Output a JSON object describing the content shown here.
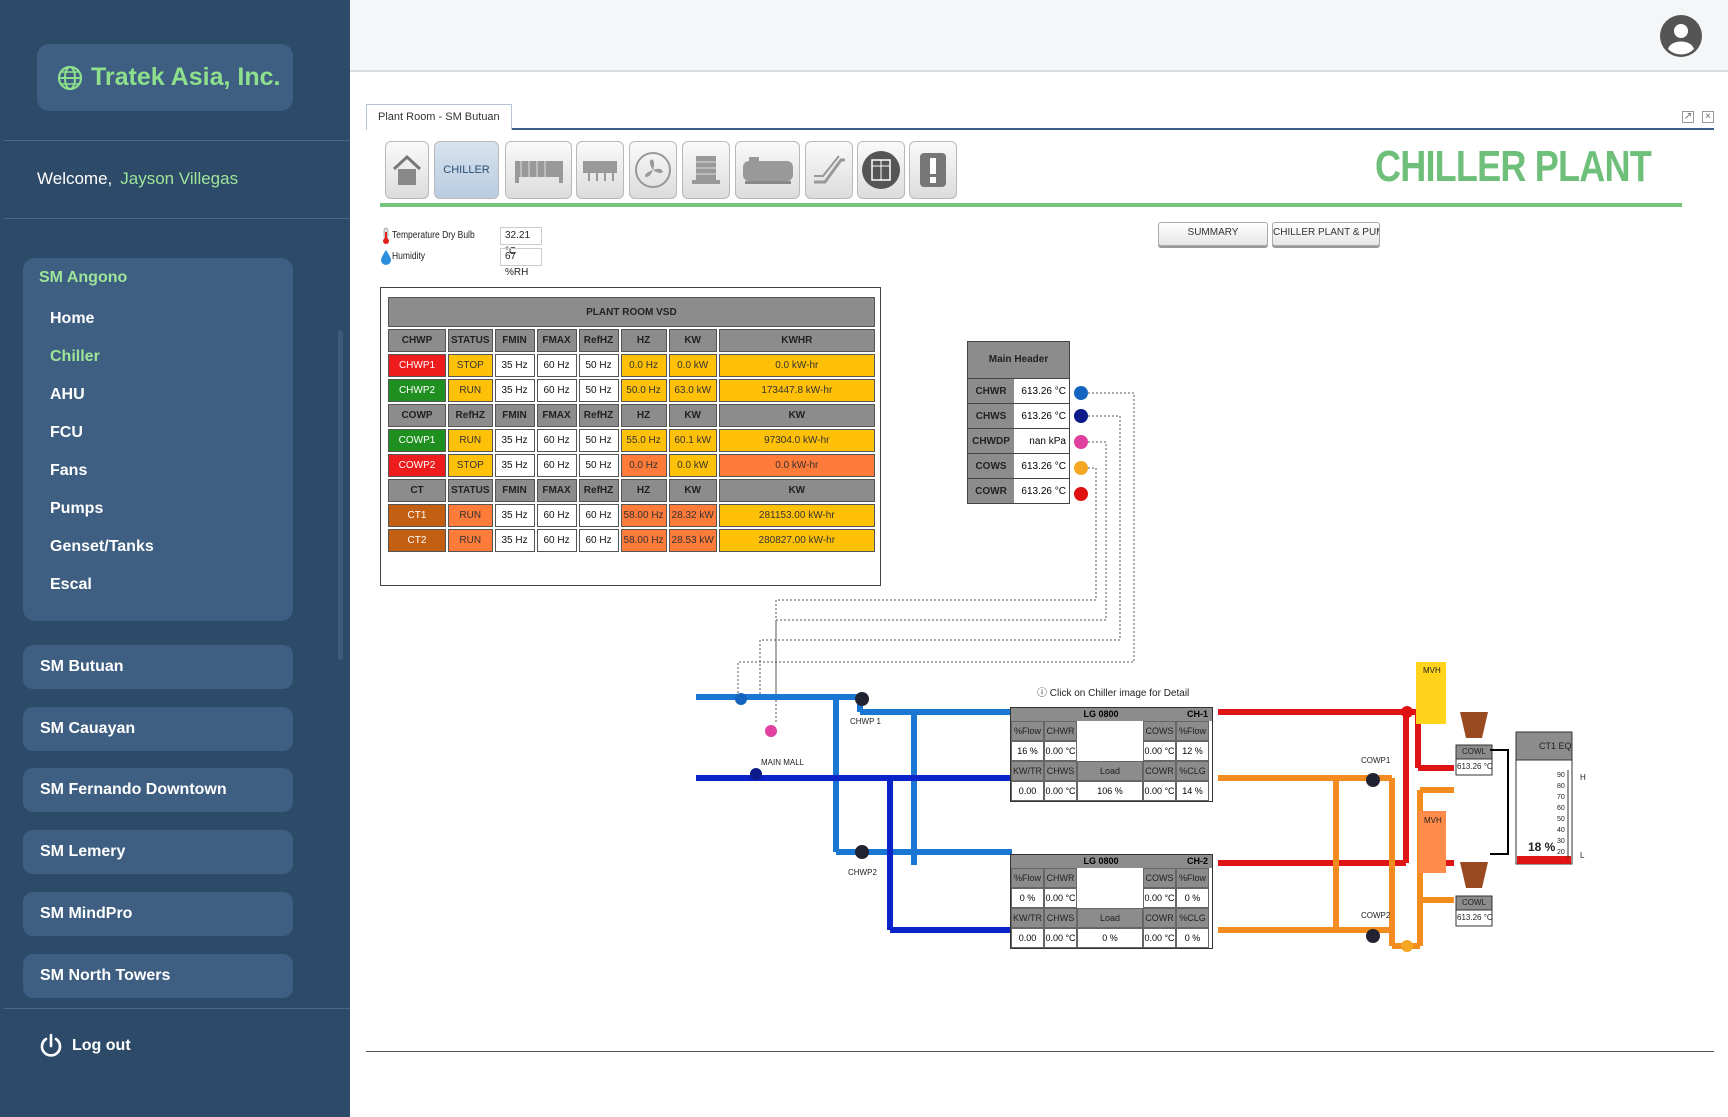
{
  "sidebar": {
    "brand": "Tratek Asia, Inc.",
    "welcome_label": "Welcome,",
    "user_name": "Jayson Villegas",
    "open_site": {
      "name": "SM Angono",
      "items": [
        "Home",
        "Chiller",
        "AHU",
        "FCU",
        "Fans",
        "Pumps",
        "Genset/Tanks",
        "Escal"
      ],
      "active": "Chiller"
    },
    "sites": [
      "SM Butuan",
      "SM Cauayan",
      "SM Fernando Downtown",
      "SM Lemery",
      "SM MindPro",
      "SM North Towers"
    ],
    "logout": "Log out"
  },
  "panel": {
    "tab_label": "Plant Room - SM Butuan",
    "chiller_button": "CHILLER",
    "title": "CHILLER PLANT",
    "weather": [
      {
        "label": "Temperature Dry Bulb",
        "value": "32.21 °C"
      },
      {
        "label": "Humidity",
        "value": "67 %RH"
      }
    ],
    "nav_buttons": [
      "SUMMARY",
      "CHILLER PLANT & PUM"
    ]
  },
  "vsd": {
    "title": "PLANT ROOM VSD",
    "chwp_headers": [
      "CHWP",
      "STATUS",
      "FMIN",
      "FMAX",
      "RefHZ",
      "HZ",
      "KW",
      "KWHR"
    ],
    "chwp_rows": [
      [
        "CHWP1",
        "STOP",
        "35 Hz",
        "60 Hz",
        "50 Hz",
        "0.0 Hz",
        "0.0 kW",
        "0.0 kW-hr"
      ],
      [
        "CHWP2",
        "RUN",
        "35 Hz",
        "60 Hz",
        "50 Hz",
        "50.0 Hz",
        "63.0 kW",
        "173447.8 kW-hr"
      ]
    ],
    "cowp_headers": [
      "COWP",
      "RefHZ",
      "FMIN",
      "FMAX",
      "RefHZ",
      "HZ",
      "KW",
      "KW"
    ],
    "cowp_rows": [
      [
        "COWP1",
        "RUN",
        "35 Hz",
        "60 Hz",
        "50 Hz",
        "55.0 Hz",
        "60.1 kW",
        "97304.0 kW-hr"
      ],
      [
        "COWP2",
        "STOP",
        "35 Hz",
        "60 Hz",
        "50 Hz",
        "0.0 Hz",
        "0.0 kW",
        "0.0 kW-hr"
      ]
    ],
    "ct_headers": [
      "CT",
      "STATUS",
      "FMIN",
      "FMAX",
      "RefHZ",
      "HZ",
      "KW",
      "KW"
    ],
    "ct_rows": [
      [
        "CT1",
        "RUN",
        "35 Hz",
        "60 Hz",
        "60 Hz",
        "58.00 Hz",
        "28.32 kW",
        "281153.00 kW-hr"
      ],
      [
        "CT2",
        "RUN",
        "35 Hz",
        "60 Hz",
        "60 Hz",
        "58.00 Hz",
        "28.53 kW",
        "280827.00 kW-hr"
      ]
    ]
  },
  "main_header": {
    "title": "Main Header",
    "rows": [
      {
        "key": "CHWR",
        "value": "613.26 °C",
        "badge": "T",
        "color": "#1565c0"
      },
      {
        "key": "CHWS",
        "value": "613.26 °C",
        "badge": "T",
        "color": "#0d1a8a"
      },
      {
        "key": "CHWDP",
        "value": "nan kPa",
        "badge": "DP",
        "color": "#e040a0"
      },
      {
        "key": "COWS",
        "value": "613.26 °C",
        "badge": "T",
        "color": "#f5a623"
      },
      {
        "key": "COWR",
        "value": "613.26 °C",
        "badge": "T",
        "color": "#e01010"
      }
    ]
  },
  "diagram": {
    "hint": "Click on Chiller image for Detail",
    "labels": {
      "chwp1": "CHWP 1",
      "chwp2": "CHWP2",
      "main_mall": "MAIN MALL",
      "cowp1": "COWP1",
      "cowp2": "COWP2",
      "mvh": "MVH",
      "cowl": "COWL",
      "ct_eq": "CT1 EQ"
    },
    "ct_temps": [
      "613.26 °C",
      "613.26 °C"
    ],
    "ct_eq_percent": "18 %",
    "gauge_ticks": [
      "90",
      "80",
      "70",
      "60",
      "50",
      "40",
      "30",
      "20"
    ],
    "gauge_marks": [
      "H",
      "L"
    ],
    "chillers": [
      {
        "name": "CH-1",
        "model": "LG 0800",
        "row1_heads": [
          "%Flow",
          "CHWR",
          "COWS",
          "%Flow"
        ],
        "row1_vals": [
          "16 %",
          "0.00 °C",
          "0.00 °C",
          "12 %"
        ],
        "row2_heads": [
          "KW/TR",
          "CHWS",
          "Load",
          "COWR",
          "%CLG"
        ],
        "row2_vals": [
          "0.00",
          "0.00 °C",
          "106 %",
          "0.00 °C",
          "14 %"
        ]
      },
      {
        "name": "CH-2",
        "model": "LG 0800",
        "row1_heads": [
          "%Flow",
          "CHWR",
          "COWS",
          "%Flow"
        ],
        "row1_vals": [
          "0 %",
          "0.00 °C",
          "0.00 °C",
          "0 %"
        ],
        "row2_heads": [
          "KW/TR",
          "CHWS",
          "Load",
          "COWR",
          "%CLG"
        ],
        "row2_vals": [
          "0.00",
          "0.00 °C",
          "0 %",
          "0.00 °C",
          "0 %"
        ]
      }
    ]
  },
  "colors": {
    "sidebar_bg": "#2d4a69",
    "accent_green": "#8ee08c",
    "title_green": "#6dbf7a",
    "chw_blue": "#1976d2",
    "chw_dark": "#0b24c9",
    "cw_red": "#e01414",
    "cw_orange": "#f28c1e"
  }
}
